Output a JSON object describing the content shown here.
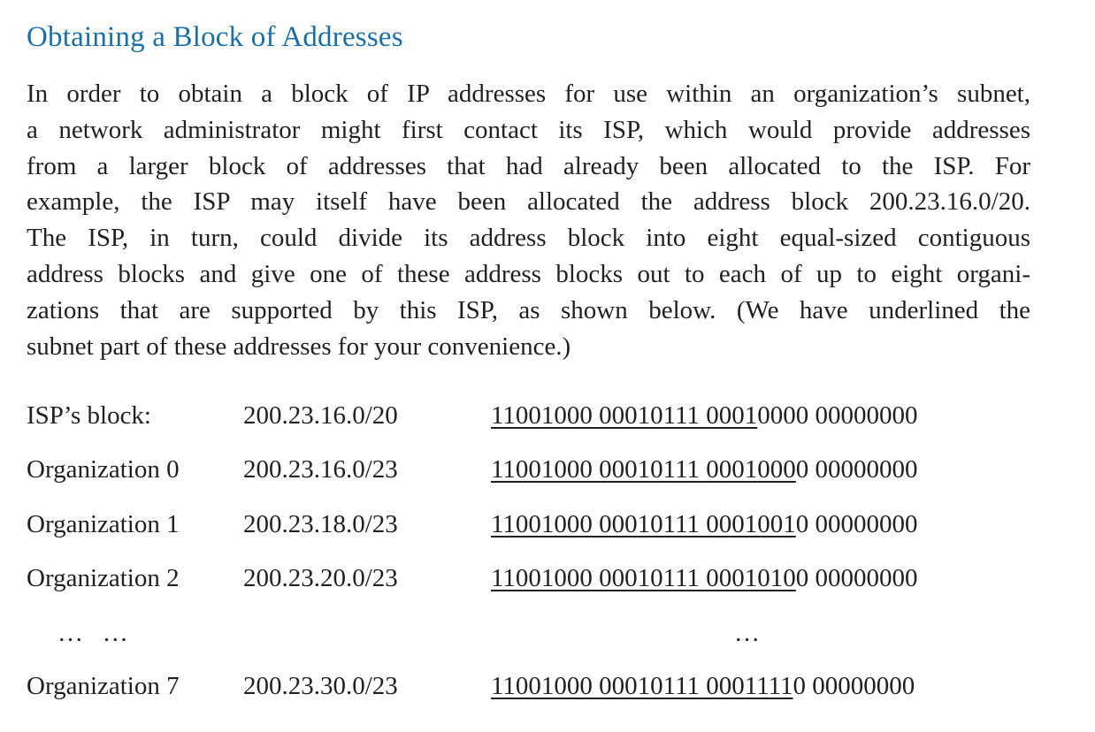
{
  "heading": "Obtaining a Block of Addresses",
  "paragraph_lines": [
    "In order to obtain a block of IP addresses for use within an organization’s subnet,",
    "a network administrator might first contact its ISP, which would provide addresses",
    "from a larger block of addresses that had already been allocated to the ISP. For",
    "example, the ISP may itself have been allocated the address block 200.23.16.0/20.",
    "The ISP, in turn, could divide its address block into eight equal-sized contiguous",
    "address blocks and give one of these address blocks out to each of up to eight organi-",
    "zations that are supported by this ISP, as shown below. (We have underlined the",
    "subnet part of these addresses for your convenience.)"
  ],
  "rows": [
    {
      "label": "ISP’s block:",
      "prefix": "200.23.16.0/20",
      "subnet_bits": "11001000 00010111 0001",
      "host_bits": "0000 00000000"
    },
    {
      "label": "Organization 0",
      "prefix": "200.23.16.0/23",
      "subnet_bits": "11001000 00010111 0001000",
      "host_bits": "0 00000000"
    },
    {
      "label": "Organization 1",
      "prefix": "200.23.18.0/23",
      "subnet_bits": "11001000 00010111 0001001",
      "host_bits": "0 00000000"
    },
    {
      "label": "Organization 2",
      "prefix": "200.23.20.0/23",
      "subnet_bits": "11001000 00010111 0001010",
      "host_bits": "0 00000000"
    },
    {
      "label": "Organization 7",
      "prefix": "200.23.30.0/23",
      "subnet_bits": "11001000 00010111 0001111",
      "host_bits": "0 00000000"
    }
  ],
  "ellipsis": {
    "left": "…   …",
    "right": "…"
  }
}
